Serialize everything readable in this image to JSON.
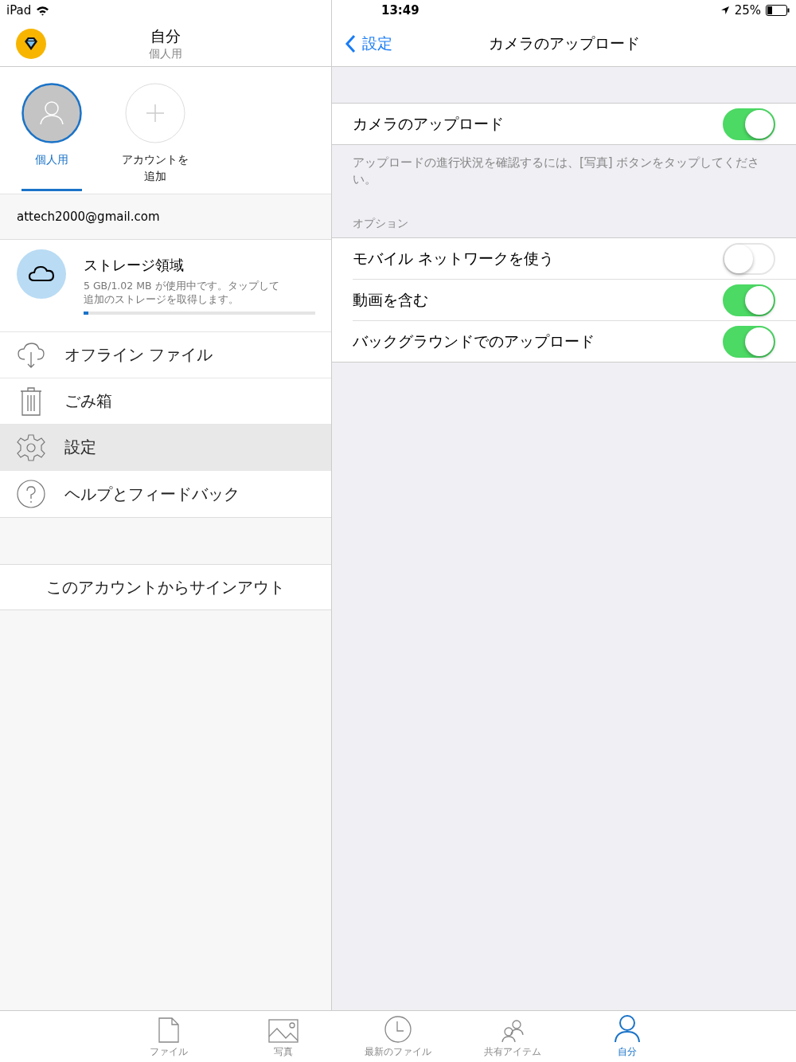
{
  "status_bar": {
    "device": "iPad",
    "time": "13:49",
    "battery": "25%"
  },
  "sidebar": {
    "title": "自分",
    "subtitle": "個人用",
    "accounts": [
      {
        "kind": "person",
        "label": "個人用",
        "selected": true
      },
      {
        "kind": "add",
        "label": "アカウントを追加",
        "selected": false
      }
    ],
    "email": "attech2000@gmail.com",
    "storage": {
      "title": "ストレージ領域",
      "detail": "5 GB/1.02 MB が使用中です。タップして追加のストレージを取得します。",
      "level": 0.02
    },
    "items": [
      {
        "kind": "offline",
        "label": "オフライン ファイル",
        "selected": false
      },
      {
        "kind": "trash",
        "label": "ごみ箱",
        "selected": false
      },
      {
        "kind": "settings",
        "label": "設定",
        "selected": true
      },
      {
        "kind": "help",
        "label": "ヘルプとフィードバック",
        "selected": false
      }
    ],
    "sign_out": "このアカウントからサインアウト"
  },
  "detail": {
    "back": "設定",
    "title": "カメラのアップロード",
    "main_toggle": {
      "label": "カメラのアップロード",
      "on": true
    },
    "note": "アップロードの進行状況を確認するには、[写真] ボタンをタップしてください。",
    "options_header": "オプション",
    "options": [
      {
        "label": "モバイル ネットワークを使う",
        "on": false
      },
      {
        "label": "動画を含む",
        "on": true
      },
      {
        "label": "バックグラウンドでのアップロード",
        "on": true
      }
    ]
  },
  "tab_bar": [
    {
      "kind": "files",
      "label": "ファイル",
      "selected": false
    },
    {
      "kind": "photos",
      "label": "写真",
      "selected": false
    },
    {
      "kind": "recent",
      "label": "最新のファイル",
      "selected": false
    },
    {
      "kind": "shared",
      "label": "共有アイテム",
      "selected": false
    },
    {
      "kind": "me",
      "label": "自分",
      "selected": true
    }
  ]
}
